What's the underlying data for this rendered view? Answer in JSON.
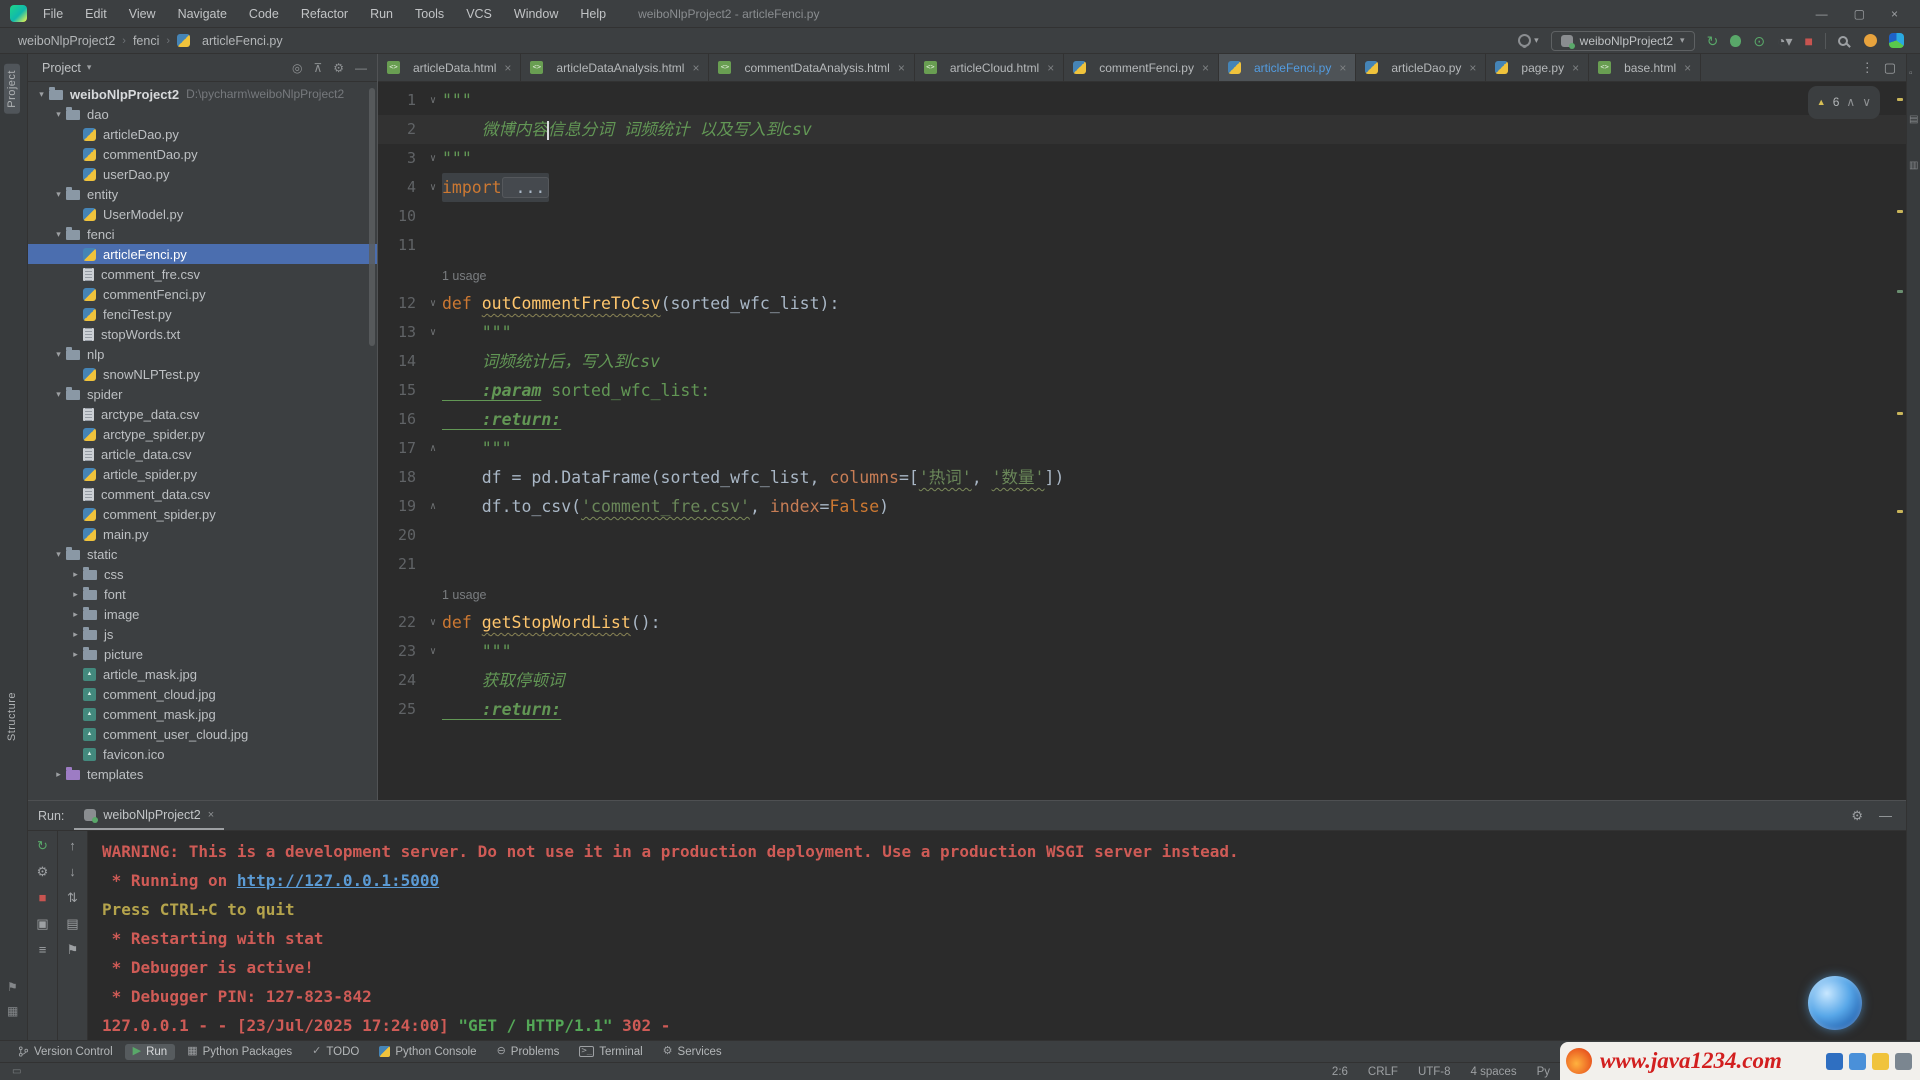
{
  "titlebar": {
    "menus": [
      "File",
      "Edit",
      "View",
      "Navigate",
      "Code",
      "Refactor",
      "Run",
      "Tools",
      "VCS",
      "Window",
      "Help"
    ],
    "title": "weiboNlpProject2 - articleFenci.py",
    "window_buttons": [
      "—",
      "▢",
      "×"
    ]
  },
  "navbar": {
    "breadcrumbs": [
      "weiboNlpProject2",
      "fenci",
      "articleFenci.py"
    ],
    "run_config": "weiboNlpProject2",
    "actions": [
      "rerun",
      "debug",
      "coverage",
      "profiler",
      "stop",
      "search",
      "notifications",
      "app"
    ]
  },
  "left_stripe": {
    "top_label": "Project",
    "bottom_label": "Structure"
  },
  "project_panel": {
    "title": "Project",
    "actions": [
      "locate",
      "collapse-all",
      "settings",
      "hide"
    ],
    "tree": [
      {
        "d": 0,
        "a": "v",
        "i": "folder",
        "l": "weiboNlpProject2",
        "b": true,
        "x": "D:\\pycharm\\weiboNlpProject2"
      },
      {
        "d": 1,
        "a": "v",
        "i": "folder",
        "l": "dao"
      },
      {
        "d": 2,
        "i": "py",
        "l": "articleDao.py"
      },
      {
        "d": 2,
        "i": "py",
        "l": "commentDao.py"
      },
      {
        "d": 2,
        "i": "py",
        "l": "userDao.py"
      },
      {
        "d": 1,
        "a": "v",
        "i": "folder",
        "l": "entity"
      },
      {
        "d": 2,
        "i": "py",
        "l": "UserModel.py"
      },
      {
        "d": 1,
        "a": "v",
        "i": "folder",
        "l": "fenci"
      },
      {
        "d": 2,
        "i": "py",
        "l": "articleFenci.py",
        "sel": true
      },
      {
        "d": 2,
        "i": "csv",
        "l": "comment_fre.csv"
      },
      {
        "d": 2,
        "i": "py",
        "l": "commentFenci.py"
      },
      {
        "d": 2,
        "i": "py",
        "l": "fenciTest.py"
      },
      {
        "d": 2,
        "i": "txt",
        "l": "stopWords.txt"
      },
      {
        "d": 1,
        "a": "v",
        "i": "folder",
        "l": "nlp"
      },
      {
        "d": 2,
        "i": "py",
        "l": "snowNLPTest.py"
      },
      {
        "d": 1,
        "a": "v",
        "i": "folder",
        "l": "spider"
      },
      {
        "d": 2,
        "i": "csv",
        "l": "arctype_data.csv"
      },
      {
        "d": 2,
        "i": "py",
        "l": "arctype_spider.py"
      },
      {
        "d": 2,
        "i": "csv",
        "l": "article_data.csv"
      },
      {
        "d": 2,
        "i": "py",
        "l": "article_spider.py"
      },
      {
        "d": 2,
        "i": "csv",
        "l": "comment_data.csv"
      },
      {
        "d": 2,
        "i": "py",
        "l": "comment_spider.py"
      },
      {
        "d": 2,
        "i": "py",
        "l": "main.py"
      },
      {
        "d": 1,
        "a": "v",
        "i": "folder",
        "l": "static"
      },
      {
        "d": 2,
        "a": ">",
        "i": "folder",
        "l": "css"
      },
      {
        "d": 2,
        "a": ">",
        "i": "folder",
        "l": "font"
      },
      {
        "d": 2,
        "a": ">",
        "i": "folder",
        "l": "image"
      },
      {
        "d": 2,
        "a": ">",
        "i": "folder",
        "l": "js"
      },
      {
        "d": 2,
        "a": ">",
        "i": "folder",
        "l": "picture"
      },
      {
        "d": 2,
        "i": "jpg",
        "l": "article_mask.jpg"
      },
      {
        "d": 2,
        "i": "jpg",
        "l": "comment_cloud.jpg"
      },
      {
        "d": 2,
        "i": "jpg",
        "l": "comment_mask.jpg"
      },
      {
        "d": 2,
        "i": "jpg",
        "l": "comment_user_cloud.jpg"
      },
      {
        "d": 2,
        "i": "ico",
        "l": "favicon.ico"
      },
      {
        "d": 1,
        "a": ">",
        "i": "folder-templates",
        "l": "templates"
      }
    ]
  },
  "tabs": [
    {
      "label": "articleData.html",
      "type": "html"
    },
    {
      "label": "articleDataAnalysis.html",
      "type": "html"
    },
    {
      "label": "commentDataAnalysis.html",
      "type": "html"
    },
    {
      "label": "articleCloud.html",
      "type": "html"
    },
    {
      "label": "commentFenci.py",
      "type": "py"
    },
    {
      "label": "articleFenci.py",
      "type": "py",
      "active": true
    },
    {
      "label": "articleDao.py",
      "type": "py"
    },
    {
      "label": "page.py",
      "type": "py"
    },
    {
      "label": "base.html",
      "type": "html"
    }
  ],
  "editor": {
    "inspections": "6",
    "lines": [
      {
        "n": "1",
        "fold": "v",
        "seg": [
          [
            "q",
            "\"\"\""
          ]
        ]
      },
      {
        "n": "2",
        "cur": true,
        "seg": [
          [
            "c",
            "    微博内容"
          ],
          [
            "caret",
            ""
          ],
          [
            "c",
            "信息分词 词频统计 以及写入到csv"
          ]
        ]
      },
      {
        "n": "3",
        "fold": "v",
        "seg": [
          [
            "q",
            "\"\"\""
          ]
        ]
      },
      {
        "n": "4",
        "fold": "v",
        "hl": true,
        "seg": [
          [
            "k",
            "import"
          ],
          [
            "fb",
            " ..."
          ]
        ]
      },
      {
        "n": "10",
        "seg": []
      },
      {
        "n": "11",
        "seg": []
      },
      {
        "u": "1 usage"
      },
      {
        "n": "12",
        "fold": "v",
        "seg": [
          [
            "k",
            "def"
          ],
          [
            "p",
            " "
          ],
          [
            "f",
            "outCommentFreToCsv"
          ],
          [
            "p",
            "(sorted_wfc_list):"
          ]
        ]
      },
      {
        "n": "13",
        "fold": "v",
        "seg": [
          [
            "q",
            "    \"\"\""
          ]
        ]
      },
      {
        "n": "14",
        "seg": [
          [
            "c",
            "    词频统计后，写入到csv"
          ]
        ]
      },
      {
        "n": "15",
        "seg": [
          [
            "t",
            "    :param"
          ],
          [
            "q",
            " sorted_wfc_list:"
          ]
        ]
      },
      {
        "n": "16",
        "seg": [
          [
            "t",
            "    :return:"
          ]
        ]
      },
      {
        "n": "17",
        "fold": "^",
        "seg": [
          [
            "q",
            "    \"\"\""
          ]
        ]
      },
      {
        "n": "18",
        "seg": [
          [
            "p",
            "    df = pd.DataFrame(sorted_wfc_list, "
          ],
          [
            "n",
            "columns"
          ],
          [
            "p",
            "=["
          ],
          [
            "sw",
            "'热词'"
          ],
          [
            "p",
            ", "
          ],
          [
            "sw",
            "'数量'"
          ],
          [
            "p",
            "])"
          ]
        ]
      },
      {
        "n": "19",
        "fold": "^",
        "seg": [
          [
            "p",
            "    df.to_csv("
          ],
          [
            "sw",
            "'comment_fre.csv'"
          ],
          [
            "p",
            ", "
          ],
          [
            "n",
            "index"
          ],
          [
            "p",
            "="
          ],
          [
            "k",
            "False"
          ],
          [
            "p",
            ")"
          ]
        ]
      },
      {
        "n": "20",
        "seg": []
      },
      {
        "n": "21",
        "seg": []
      },
      {
        "u": "1 usage"
      },
      {
        "n": "22",
        "fold": "v",
        "seg": [
          [
            "k",
            "def"
          ],
          [
            "p",
            " "
          ],
          [
            "f",
            "getStopWordList"
          ],
          [
            "p",
            "():"
          ]
        ]
      },
      {
        "n": "23",
        "fold": "v",
        "seg": [
          [
            "q",
            "    \"\"\""
          ]
        ]
      },
      {
        "n": "24",
        "seg": [
          [
            "c",
            "    获取停顿词"
          ]
        ]
      },
      {
        "n": "25",
        "seg": [
          [
            "t",
            "    :return:"
          ]
        ]
      }
    ]
  },
  "run_panel": {
    "label": "Run:",
    "tab": "weiboNlpProject2",
    "toolbar1": [
      "rerun",
      "edit-config",
      "stop",
      "restore-layout",
      "soft-wrap"
    ],
    "toolbar2": [
      "up",
      "down",
      "sort",
      "print",
      "pin"
    ],
    "console": [
      [
        [
          "r",
          "WARNING: This is a development server. Do not use it in a production deployment. Use a production WSGI server instead."
        ]
      ],
      [
        [
          "r",
          " * Running on "
        ],
        [
          "l",
          "http://127.0.0.1:5000"
        ]
      ],
      [
        [
          "y",
          "Press CTRL+C to quit"
        ]
      ],
      [
        [
          "r",
          " * Restarting with stat"
        ]
      ],
      [
        [
          "r",
          " * Debugger is active!"
        ]
      ],
      [
        [
          "r",
          " * Debugger PIN: 127-823-842"
        ]
      ],
      [
        [
          "r",
          "127.0.0.1 - - [23/Jul/2025 17:24:00] "
        ],
        [
          "g",
          "\"GET / HTTP/1.1\""
        ],
        [
          "r",
          " 302 -"
        ]
      ]
    ]
  },
  "bottom_bar": [
    {
      "icon": "branch",
      "label": "Version Control"
    },
    {
      "icon": "play",
      "label": "Run",
      "active": true
    },
    {
      "icon": "package",
      "label": "Python Packages"
    },
    {
      "icon": "todo",
      "label": "TODO"
    },
    {
      "icon": "python",
      "label": "Python Console"
    },
    {
      "icon": "problems",
      "label": "Problems"
    },
    {
      "icon": "terminal",
      "label": "Terminal"
    },
    {
      "icon": "services",
      "label": "Services"
    }
  ],
  "status_bar": {
    "items": [
      {
        "name": "caret-position",
        "text": "2:6"
      },
      {
        "name": "line-separator",
        "text": "CRLF"
      },
      {
        "name": "encoding",
        "text": "UTF-8"
      },
      {
        "name": "indent",
        "text": "4 spaces"
      },
      {
        "name": "interpreter",
        "text": "Py"
      }
    ]
  },
  "watermark": {
    "text": "www.java1234.com"
  },
  "colors": {
    "accent_blue": "#4b6eaf",
    "console_red": "#cf5b56",
    "link_blue": "#5b9bd5",
    "keyword_orange": "#cc7832",
    "string_green": "#6a8759"
  }
}
